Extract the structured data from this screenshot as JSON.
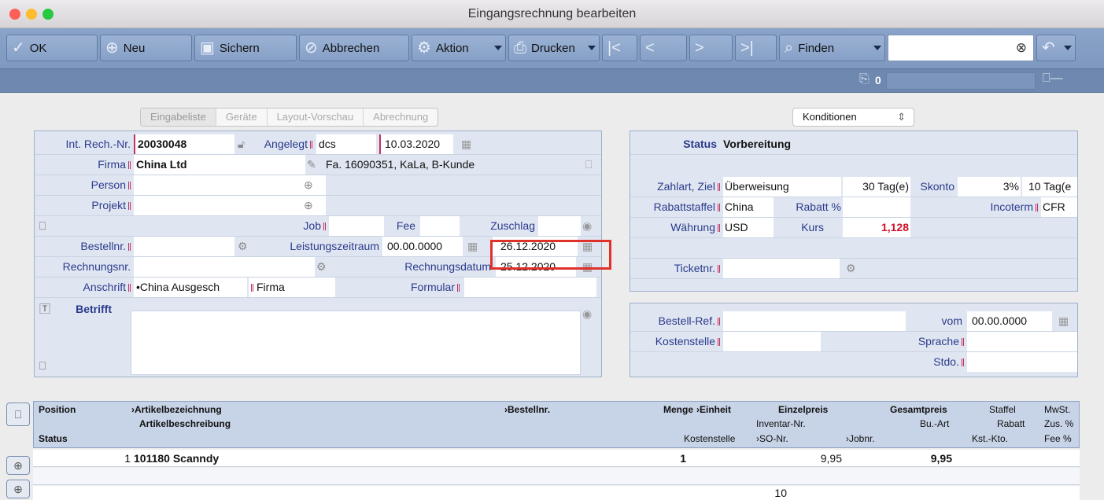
{
  "window": {
    "title": "Eingangsrechnung bearbeiten"
  },
  "toolbar": {
    "ok": "OK",
    "neu": "Neu",
    "sichern": "Sichern",
    "abbrechen": "Abbrechen",
    "aktion": "Aktion",
    "drucken": "Drucken",
    "finden": "Finden",
    "counter": "0"
  },
  "tabs": [
    "Eingabeliste",
    "Geräte",
    "Layout-Vorschau",
    "Abrechnung"
  ],
  "konditionen": "Konditionen",
  "left": {
    "int_rech_label": "Int. Rech.-Nr.",
    "int_rech_value": "20030048",
    "angelegt_label": "Angelegt",
    "angelegt_user": "dcs",
    "angelegt_date": "10.03.2020",
    "firma_label": "Firma",
    "firma_value": "China Ltd",
    "firma_info": "Fa. 16090351, KaLa, B-Kunde",
    "person_label": "Person",
    "projekt_label": "Projekt",
    "job_label": "Job",
    "fee_label": "Fee",
    "zuschlag_label": "Zuschlag",
    "bestellnr_label": "Bestellnr.",
    "leistungszeitraum_label": "Leistungszeitraum",
    "leistung_from": "00.00.0000",
    "leistung_to": "26.12.2020",
    "rechnungsnr_label": "Rechnungsnr.",
    "rechnungsdatum_label": "Rechnungsdatum",
    "rechnungsdatum_value": "25.12.2020",
    "anschrift_label": "Anschrift",
    "anschrift_value": "•China Ausgesch",
    "anschrift_type": "Firma",
    "formular_label": "Formular",
    "betrifft_label": "Betrifft"
  },
  "right": {
    "status_label": "Status",
    "status_value": "Vorbereitung",
    "zahlart_label": "Zahlart, Ziel",
    "zahlart_value": "Überweisung",
    "ziel_days": "30 Tag(e)",
    "skonto_label": "Skonto",
    "skonto_pct": "3%",
    "skonto_days": "10 Tag(e",
    "rabattstaffel_label": "Rabattstaffel",
    "rabattstaffel_value": "China",
    "rabatt_label": "Rabatt %",
    "incoterm_label": "Incoterm",
    "incoterm_value": "CFR",
    "waehrung_label": "Währung",
    "waehrung_value": "USD",
    "kurs_label": "Kurs",
    "kurs_value": "1,128",
    "ticketnr_label": "Ticketnr.",
    "bestellref_label": "Bestell-Ref.",
    "vom_label": "vom",
    "vom_value": "00.00.0000",
    "kostenstelle_label": "Kostenstelle",
    "sprache_label": "Sprache",
    "stdo_label": "Stdo."
  },
  "grid": {
    "h_position": "Position",
    "h_artikelbez": "Artikelbezeichnung",
    "h_bestellnr": "Bestellnr.",
    "h_menge": "Menge",
    "h_einheit": "Einheit",
    "h_einzelpreis": "Einzelpreis",
    "h_gesamtpreis": "Gesamtpreis",
    "h_staffel": "Staffel",
    "h_mwst": "MwSt.",
    "h_artikelbeschr": "Artikelbeschreibung",
    "h_inventar": "Inventar-Nr.",
    "h_buart": "Bu.-Art",
    "h_rabatt": "Rabatt",
    "h_zus": "Zus. %",
    "h_status": "Status",
    "h_kostenstelle": "Kostenstelle",
    "h_sonr": "SO-Nr.",
    "h_jobnr": "Jobnr.",
    "h_kstkto": "Kst.-Kto.",
    "h_fee": "Fee %",
    "row_pos": "1",
    "row_artikel": "101180 Scanndy",
    "row_menge": "1",
    "row_einzel": "9,95",
    "row_gesamt": "9,95",
    "row3_val": "10"
  },
  "colors": {
    "accent": "#7e98bf",
    "highlight": "#e0302a",
    "label": "#2b3a8c",
    "kurs": "#d0102a"
  }
}
